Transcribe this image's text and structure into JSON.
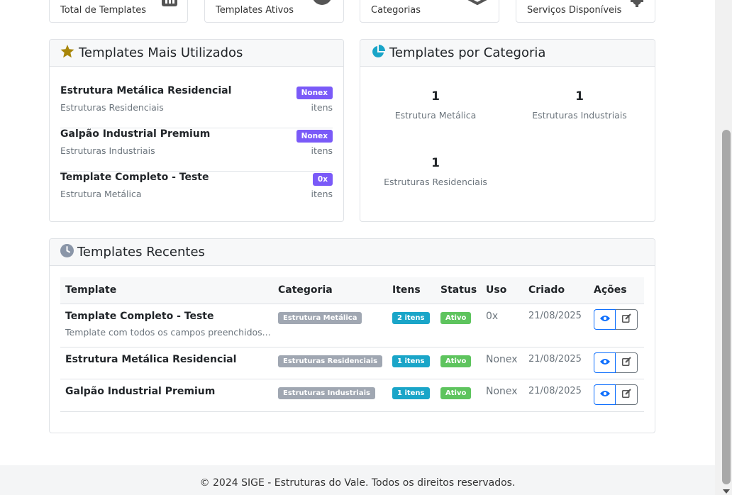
{
  "stats": [
    {
      "label": "Total de Templates",
      "icon": "chart-icon"
    },
    {
      "label": "Templates Ativos",
      "icon": "check-circle-icon"
    },
    {
      "label": "Categorias",
      "icon": "layers-icon"
    },
    {
      "label": "Serviços Disponíveis",
      "icon": "gear-icon"
    }
  ],
  "mais_utilizados": {
    "title": "Templates Mais Utilizados",
    "items": [
      {
        "name": "Estrutura Metálica Residencial",
        "category": "Estruturas Residenciais",
        "badge": "Nonex",
        "units": "itens"
      },
      {
        "name": "Galpão Industrial Premium",
        "category": "Estruturas Industriais",
        "badge": "Nonex",
        "units": "itens"
      },
      {
        "name": "Template Completo - Teste",
        "category": "Estrutura Metálica",
        "badge": "0x",
        "units": "itens"
      }
    ]
  },
  "por_categoria": {
    "title": "Templates por Categoria",
    "items": [
      {
        "count": "1",
        "label": "Estrutura Metálica"
      },
      {
        "count": "1",
        "label": "Estruturas Industriais"
      },
      {
        "count": "1",
        "label": "Estruturas Residenciais"
      }
    ]
  },
  "recentes": {
    "title": "Templates Recentes",
    "columns": [
      "Template",
      "Categoria",
      "Itens",
      "Status",
      "Uso",
      "Criado",
      "Ações"
    ],
    "rows": [
      {
        "name": "Template Completo - Teste",
        "desc": "Template com todos os campos preenchidos...",
        "category": "Estrutura Metálica",
        "itens": "2 itens",
        "status": "Ativo",
        "uso": "0x",
        "criado": "21/08/2025"
      },
      {
        "name": "Estrutura Metálica Residencial",
        "desc": "",
        "category": "Estruturas Residenciais",
        "itens": "1 itens",
        "status": "Ativo",
        "uso": "Nonex",
        "criado": "21/08/2025"
      },
      {
        "name": "Galpão Industrial Premium",
        "desc": "",
        "category": "Estruturas Industriais",
        "itens": "1 itens",
        "status": "Ativo",
        "uso": "Nonex",
        "criado": "21/08/2025"
      }
    ]
  },
  "footer": {
    "text": "© 2024 SIGE - Estruturas do Vale. Todos os direitos reservados."
  },
  "colors": {
    "accent": "#0d6efd",
    "badge_purple": "#7a5af8",
    "badge_info": "#1aa5c8",
    "badge_success": "#5ec45e",
    "badge_secondary": "#a0a7b2",
    "star": "#a8860a",
    "pie": "#1aa5c8"
  }
}
